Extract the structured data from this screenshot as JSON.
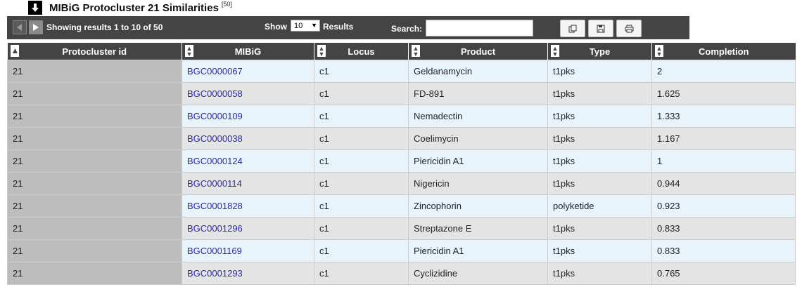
{
  "title": {
    "text": "MIBiG Protocluster 21 Similarities",
    "count": "[50]"
  },
  "toolbar": {
    "showing": "Showing results 1 to 10 of 50",
    "show_label": "Show",
    "show_value": "10",
    "results_label": "Results",
    "search_label": "Search:",
    "search_value": ""
  },
  "table": {
    "headers": [
      "Protocluster id",
      "MIBiG",
      "Locus",
      "Product",
      "Type",
      "Completion"
    ],
    "rows": [
      [
        "21",
        "BGC0000067",
        "c1",
        "Geldanamycin",
        "t1pks",
        "2"
      ],
      [
        "21",
        "BGC0000058",
        "c1",
        "FD-891",
        "t1pks",
        "1.625"
      ],
      [
        "21",
        "BGC0000109",
        "c1",
        "Nemadectin",
        "t1pks",
        "1.333"
      ],
      [
        "21",
        "BGC0000038",
        "c1",
        "Coelimycin",
        "t1pks",
        "1.167"
      ],
      [
        "21",
        "BGC0000124",
        "c1",
        "Piericidin A1",
        "t1pks",
        "1"
      ],
      [
        "21",
        "BGC0000114",
        "c1",
        "Nigericin",
        "t1pks",
        "0.944"
      ],
      [
        "21",
        "BGC0001828",
        "c1",
        "Zincophorin",
        "polyketide",
        "0.923"
      ],
      [
        "21",
        "BGC0001296",
        "c1",
        "Streptazone E",
        "t1pks",
        "0.833"
      ],
      [
        "21",
        "BGC0001169",
        "c1",
        "Piericidin A1",
        "t1pks",
        "0.833"
      ],
      [
        "21",
        "BGC0001293",
        "c1",
        "Cyclizidine",
        "t1pks",
        "0.765"
      ]
    ]
  },
  "colors": {
    "toolbar_bg": "#444444",
    "link": "#2a2aa5",
    "row_odd": "#e8f4fc",
    "row_even": "#e4e4e4",
    "id_col": "#bdbdbd"
  }
}
